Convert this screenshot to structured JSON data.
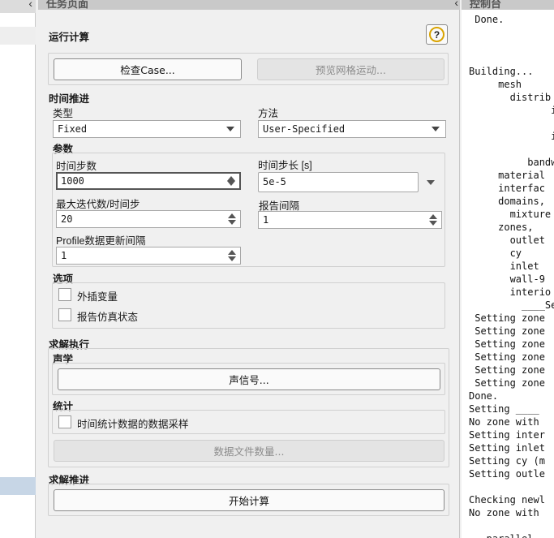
{
  "task_page": {
    "header_title": "任务页面",
    "section_title": "运行计算",
    "help_label": "?",
    "check_case_button": "检查Case...",
    "preview_mesh_button": "预览网格运动...",
    "time_advance": {
      "title": "时间推进",
      "type_label": "类型",
      "type_value": "Fixed",
      "method_label": "方法",
      "method_value": "User-Specified"
    },
    "parameters": {
      "title": "参数",
      "num_steps_label": "时间步数",
      "num_steps_value": "1000",
      "step_size_label": "时间步长 [s]",
      "step_size_value": "5e-5",
      "max_iter_label": "最大迭代数/时间步",
      "max_iter_value": "20",
      "report_interval_label": "报告间隔",
      "report_interval_value": "1",
      "profile_label": "Profile数据更新间隔",
      "profile_value": "1"
    },
    "options": {
      "title": "选项",
      "extrapolate_label": "外插变量",
      "report_sim_label": "报告仿真状态"
    },
    "solution_execution": {
      "title": "求解执行",
      "acoustics_title": "声学",
      "acoustic_signal_button": "声信号...",
      "statistics_title": "统计",
      "sampling_label": "时间统计数据的数据采样",
      "data_file_button": "数据文件数量..."
    },
    "solution_advance": {
      "title": "求解推进",
      "start_button": "开始计算"
    }
  },
  "console": {
    "header_title": "控制台",
    "lines": [
      " Done.",
      "",
      "",
      "",
      "Building...",
      "     mesh",
      "       distrib",
      "              i",
      "",
      "              i",
      "",
      "          bandw",
      "     material",
      "     interfac",
      "     domains,",
      "       mixture",
      "     zones,",
      "       outlet",
      "       cy",
      "       inlet",
      "       wall-9",
      "       interio",
      "         ____Set",
      " Setting zone",
      " Setting zone",
      " Setting zone",
      " Setting zone",
      " Setting zone",
      " Setting zone",
      "Done.",
      "Setting ____",
      "No zone with",
      "Setting inter",
      "Setting inlet",
      "Setting cy (m",
      "Setting outle",
      "",
      "Checking newl",
      "No zone with",
      "",
      "   parallel"
    ]
  }
}
